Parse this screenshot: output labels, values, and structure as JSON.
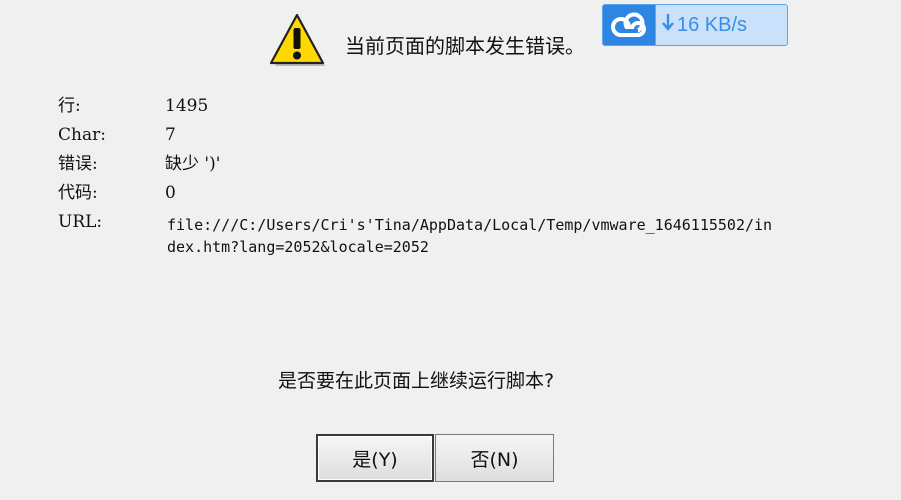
{
  "header": {
    "message": "当前页面的脚本发生错误。"
  },
  "overlay": {
    "speed": "16 KB/s",
    "icon": "cloud-icon",
    "arrow_icon": "down-arrow-icon",
    "colors": {
      "accent": "#3c8fe6",
      "light": "#c9e1fb"
    }
  },
  "details": {
    "line_label": "行:",
    "line_value": "1495",
    "char_label": "Char:",
    "char_value": "7",
    "error_label": "错误:",
    "error_value": "缺少 ')'",
    "code_label": "代码:",
    "code_value": "0",
    "url_label": "URL:",
    "url_value": "file:///C:/Users/Cri's'Tina/AppData/Local/Temp/vmware_1646115502/index.htm?lang=2052&locale=2052"
  },
  "question": "是否要在此页面上继续运行脚本?",
  "buttons": {
    "yes": "是(Y)",
    "no": "否(N)"
  },
  "colors": {
    "background": "#f0f0f0",
    "warning_yellow": "#ffd800"
  }
}
